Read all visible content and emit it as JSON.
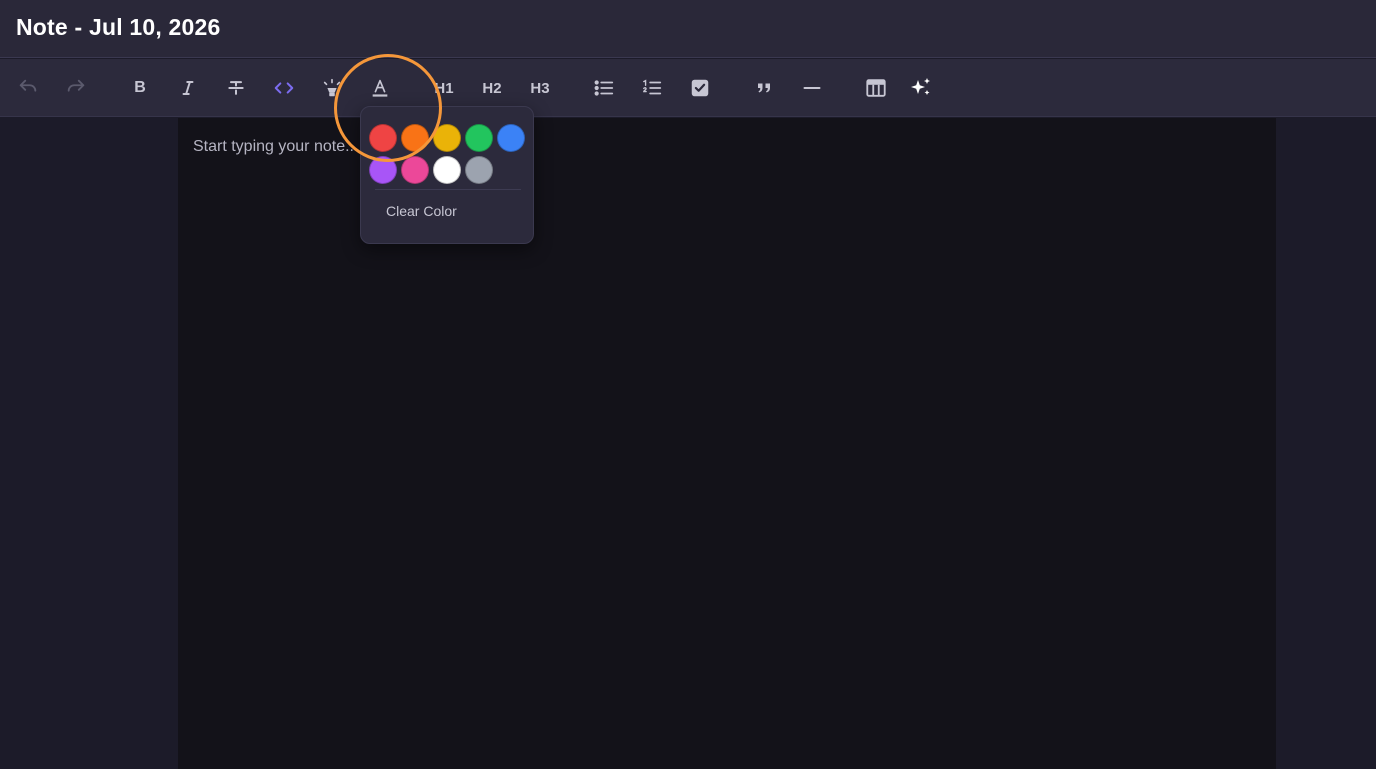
{
  "window": {
    "title": "Note - Jul 10, 2026"
  },
  "toolbar": {
    "undo": "undo-icon",
    "redo": "redo-icon",
    "bold": "B",
    "h1": "H1",
    "h2": "H2",
    "h3": "H3"
  },
  "editor": {
    "placeholder": "Start typing your note..."
  },
  "color_picker": {
    "swatches": [
      "#ef4444",
      "#f97316",
      "#eab308",
      "#22c55e",
      "#3b82f6",
      "#a855f7",
      "#ec4899",
      "#ffffff",
      "#9ca3af"
    ],
    "clear_label": "Clear Color"
  },
  "theme": {
    "accent": "#7c6cf0",
    "highlight_ring": "#f5973a"
  }
}
